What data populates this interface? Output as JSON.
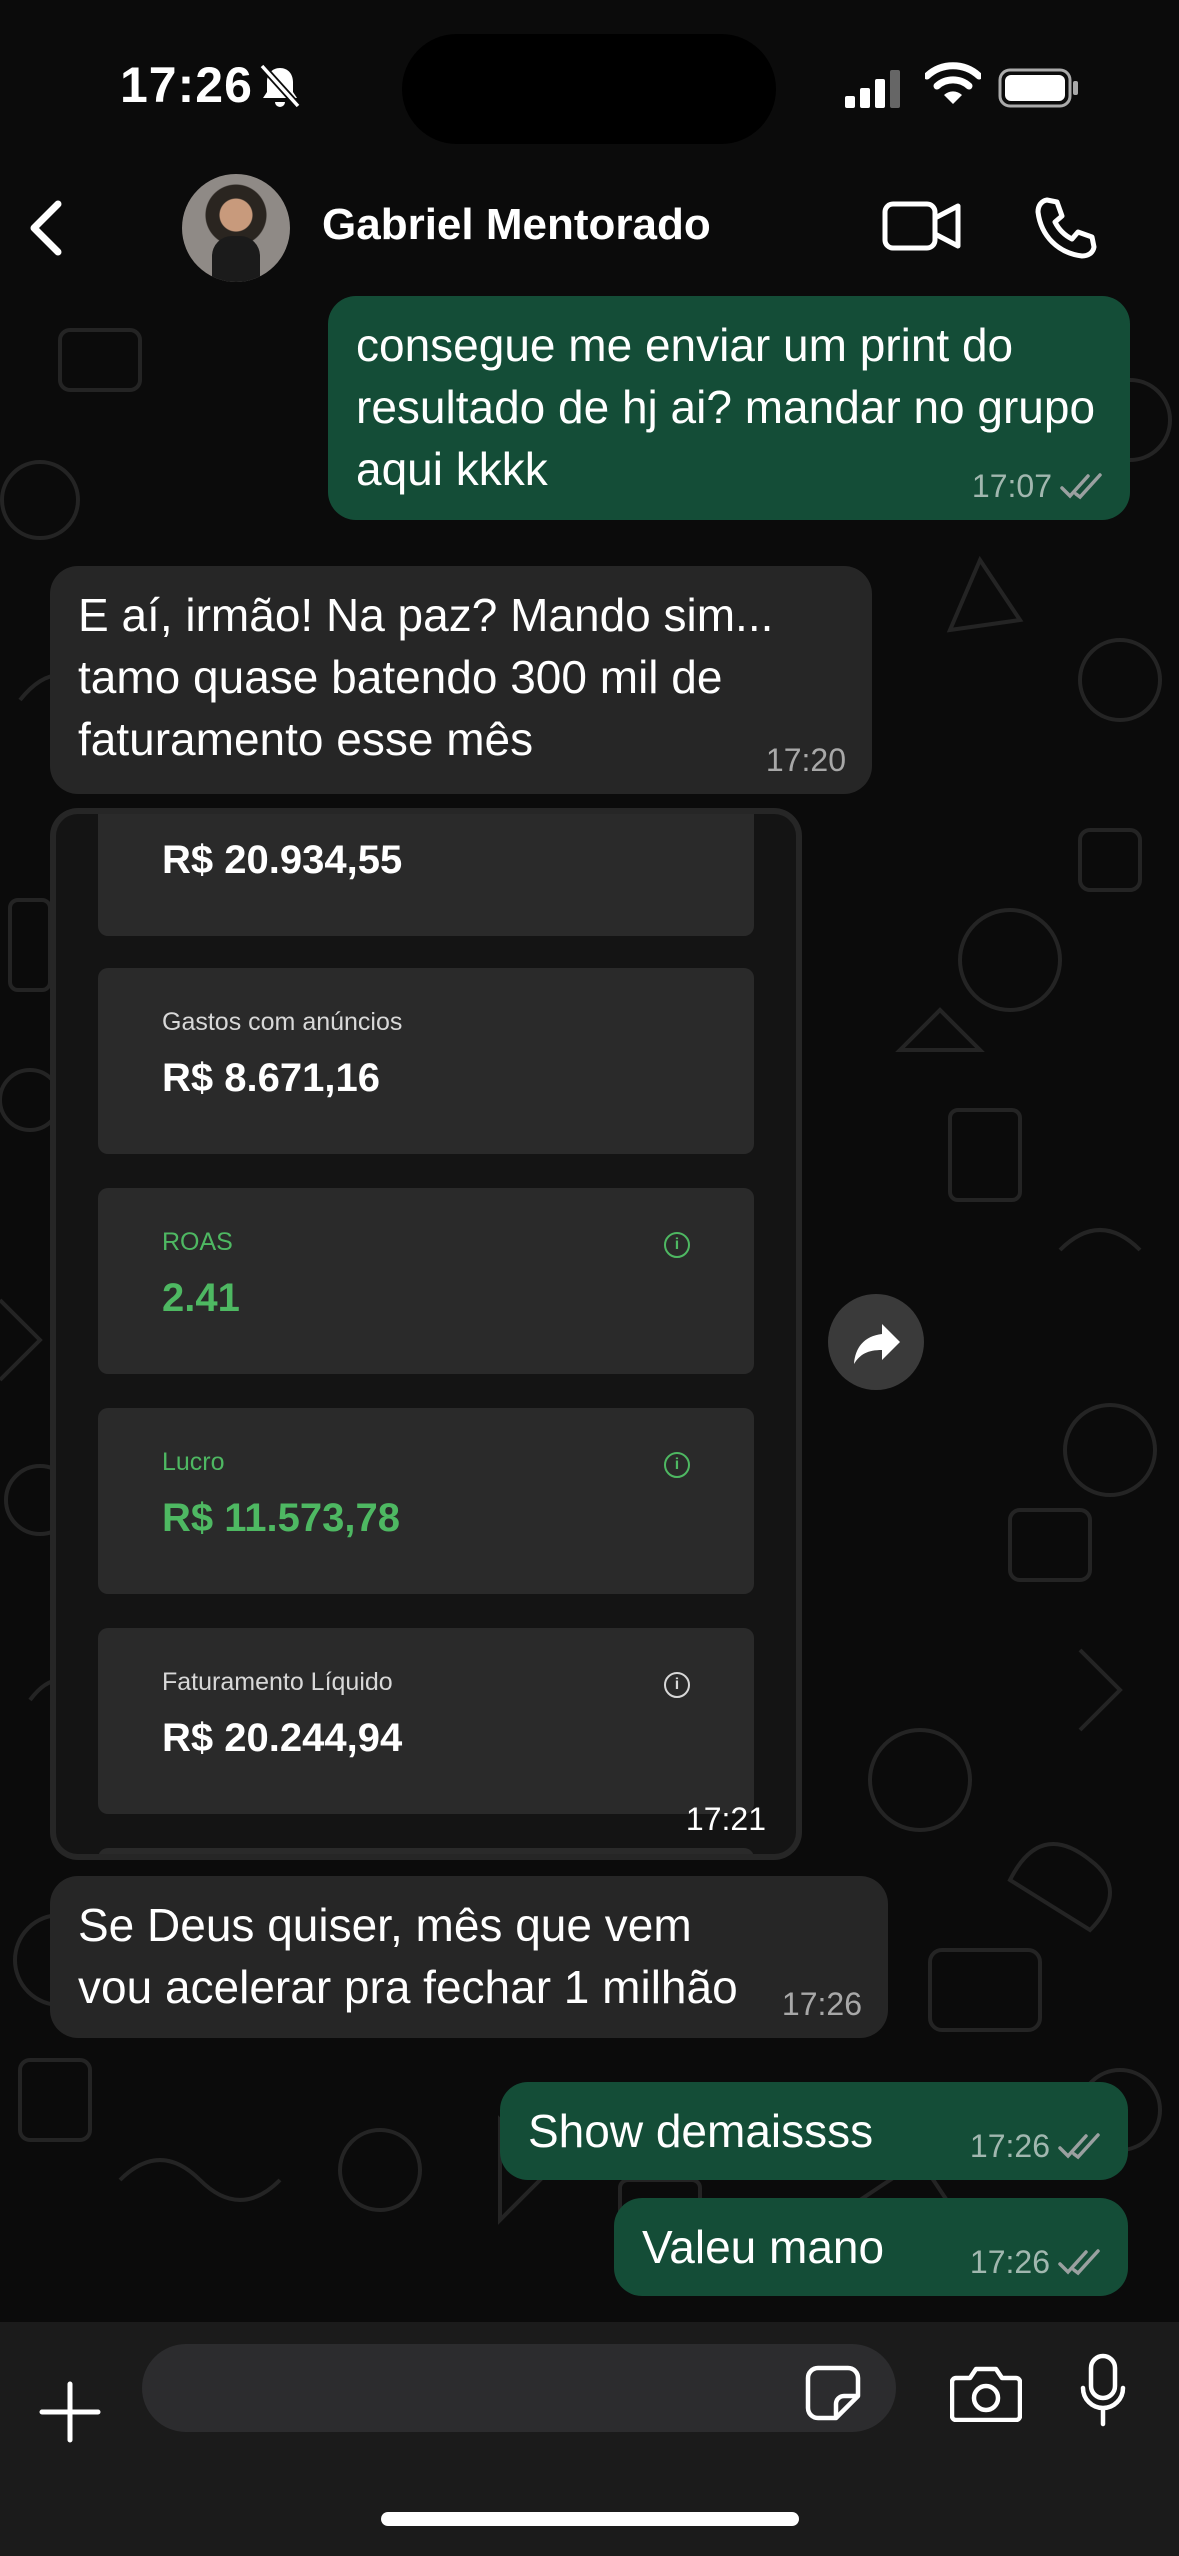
{
  "status_bar": {
    "time": "17:26"
  },
  "header": {
    "contact_name": "Gabriel Mentorado"
  },
  "messages": [
    {
      "direction": "outgoing",
      "text": "consegue me enviar um print do resultado de hj ai? mandar no grupo aqui kkkk",
      "time": "17:07",
      "read": true
    },
    {
      "direction": "incoming",
      "text": "E aí, irmão! Na paz? Mando sim... tamo quase batendo 300 mil de faturamento esse mês",
      "time": "17:20"
    },
    {
      "direction": "incoming",
      "type": "image",
      "time": "17:21",
      "cards": [
        {
          "label": "",
          "value": "R$ 20.934,55"
        },
        {
          "label": "Gastos com anúncios",
          "value": "R$ 8.671,16"
        },
        {
          "label": "ROAS",
          "value": "2.41",
          "color": "#4eb862",
          "info": "i"
        },
        {
          "label": "Lucro",
          "value": "R$ 11.573,78",
          "color": "#4eb862",
          "info": "i"
        },
        {
          "label": "Faturamento Líquido",
          "value": "R$ 20.244,94",
          "info": "i"
        }
      ]
    },
    {
      "direction": "incoming",
      "text": "Se Deus quiser, mês que vem vou acelerar pra fechar 1 milhão",
      "time": "17:26"
    },
    {
      "direction": "outgoing",
      "text": "Show demaissss",
      "time": "17:26",
      "read": true
    },
    {
      "direction": "outgoing",
      "text": "Valeu mano",
      "time": "17:26",
      "read": true
    }
  ],
  "composer": {
    "placeholder": ""
  },
  "colors": {
    "outgoing_bubble": "#144d37",
    "incoming_bubble": "#262626",
    "positive_metric": "#4eb862"
  },
  "icons": [
    "bell-off-icon",
    "signal-icon",
    "wifi-icon",
    "battery-icon",
    "back-chevron-icon",
    "video-call-icon",
    "phone-icon",
    "double-check-icon",
    "forward-icon",
    "plus-icon",
    "sticker-icon",
    "camera-icon",
    "microphone-icon"
  ]
}
